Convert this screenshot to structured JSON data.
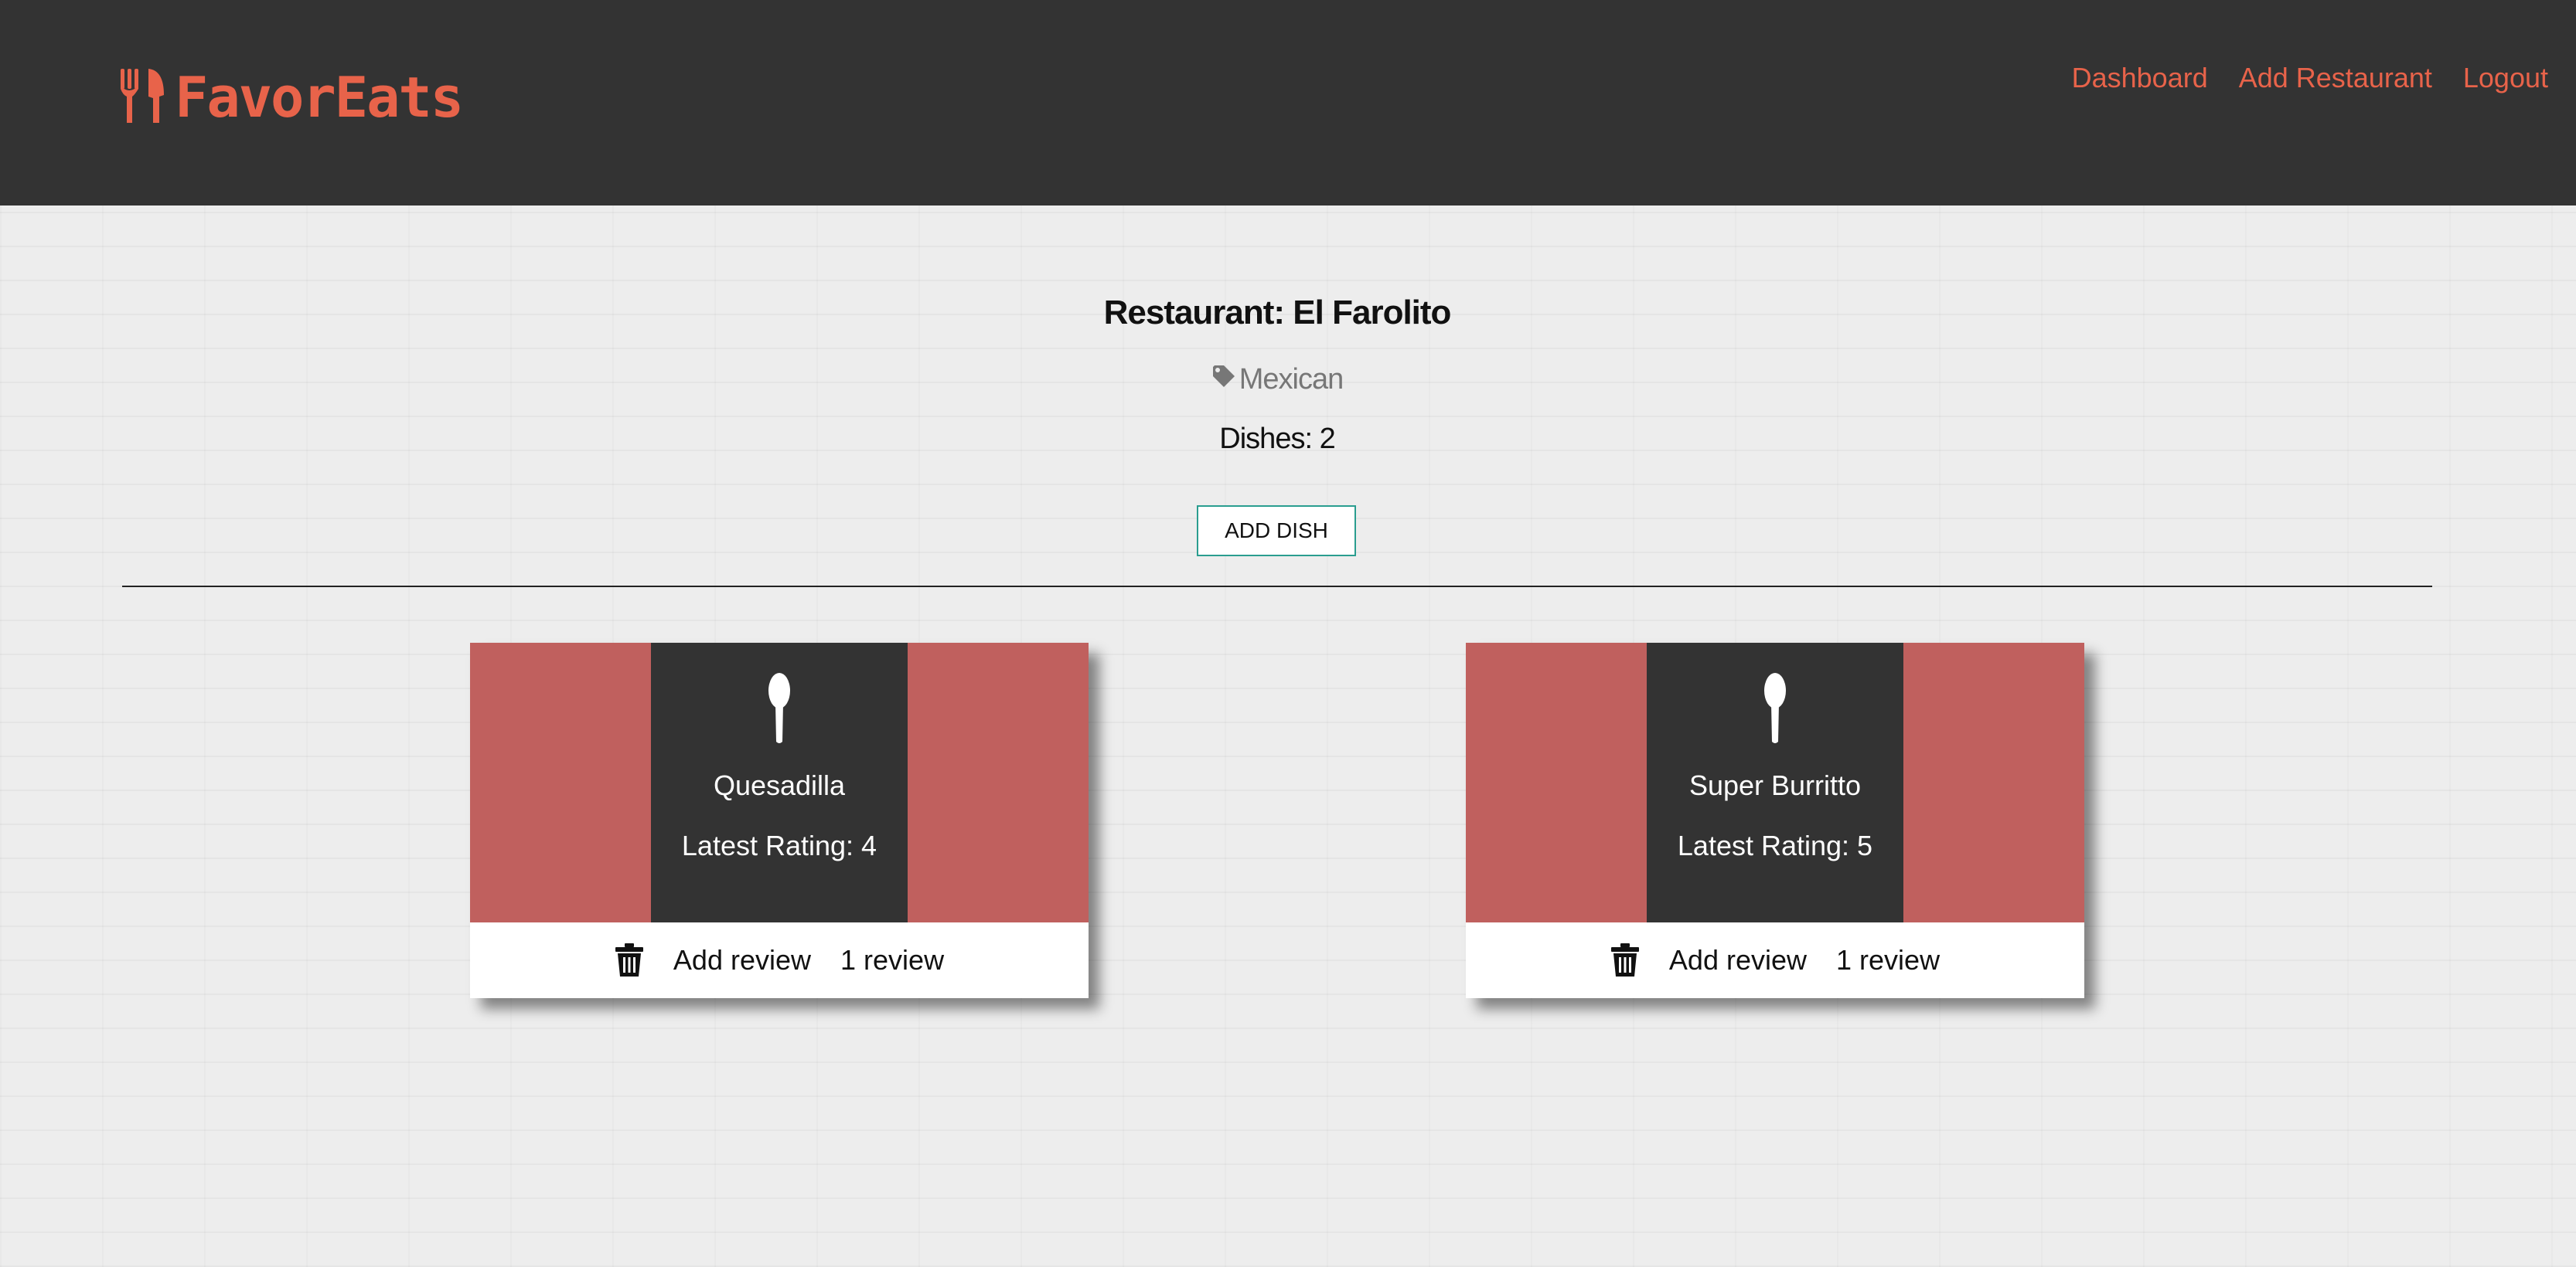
{
  "nav": {
    "brand": "FavorEats",
    "links": [
      "Dashboard",
      "Add Restaurant",
      "Logout"
    ]
  },
  "restaurant": {
    "title": "Restaurant: El Farolito",
    "cuisine": "Mexican",
    "dish_count": "Dishes: 2",
    "add_dish_label": "ADD DISH"
  },
  "colors": {
    "accent": "#e8634a",
    "navbar": "#333333",
    "card_side": "#c0605e",
    "button_border": "#2a9d8f"
  },
  "dishes": [
    {
      "icon": "spoon-icon",
      "name": "Quesadilla",
      "rating": "Latest Rating: 4",
      "add_review": "Add review",
      "reviews": "1 review"
    },
    {
      "icon": "spoon-icon",
      "name": "Super Burritto",
      "rating": "Latest Rating: 5",
      "add_review": "Add review",
      "reviews": "1 review"
    }
  ]
}
